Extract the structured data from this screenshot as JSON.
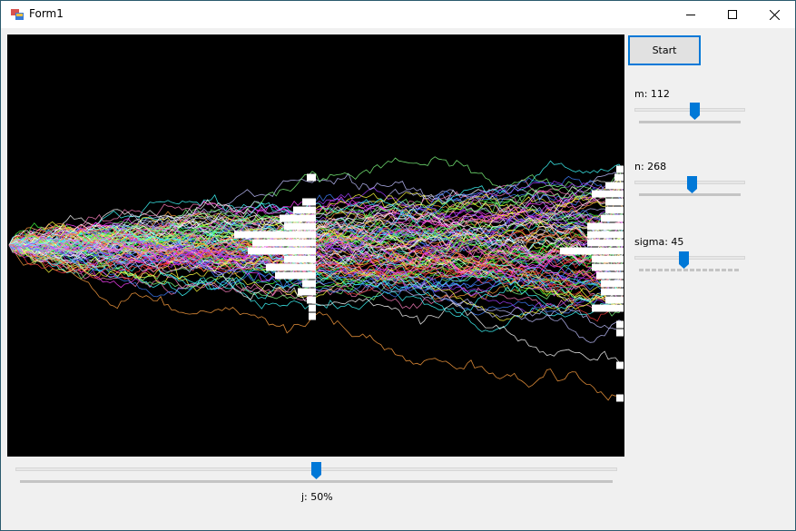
{
  "window": {
    "title": "Form1"
  },
  "controls": {
    "start_label": "Start",
    "m": {
      "label": "m: 112",
      "value": 112
    },
    "n": {
      "label": "n: 268",
      "value": 268
    },
    "sigma": {
      "label": "sigma: 45",
      "value": 45
    },
    "j": {
      "label": "j: 50%",
      "value": 50
    }
  },
  "icons": [
    "app-icon",
    "minimize-icon",
    "maximize-icon",
    "close-icon"
  ],
  "colors": {
    "accent": "#0078d7",
    "canvas_bg": "#000000",
    "path_palette": [
      "#ffffff",
      "#ff4040",
      "#40ff40",
      "#4080ff",
      "#ffff40",
      "#ff40ff",
      "#40ffff",
      "#ffa040",
      "#a040ff",
      "#ff80c0",
      "#80ff80",
      "#c0c0ff"
    ]
  }
}
